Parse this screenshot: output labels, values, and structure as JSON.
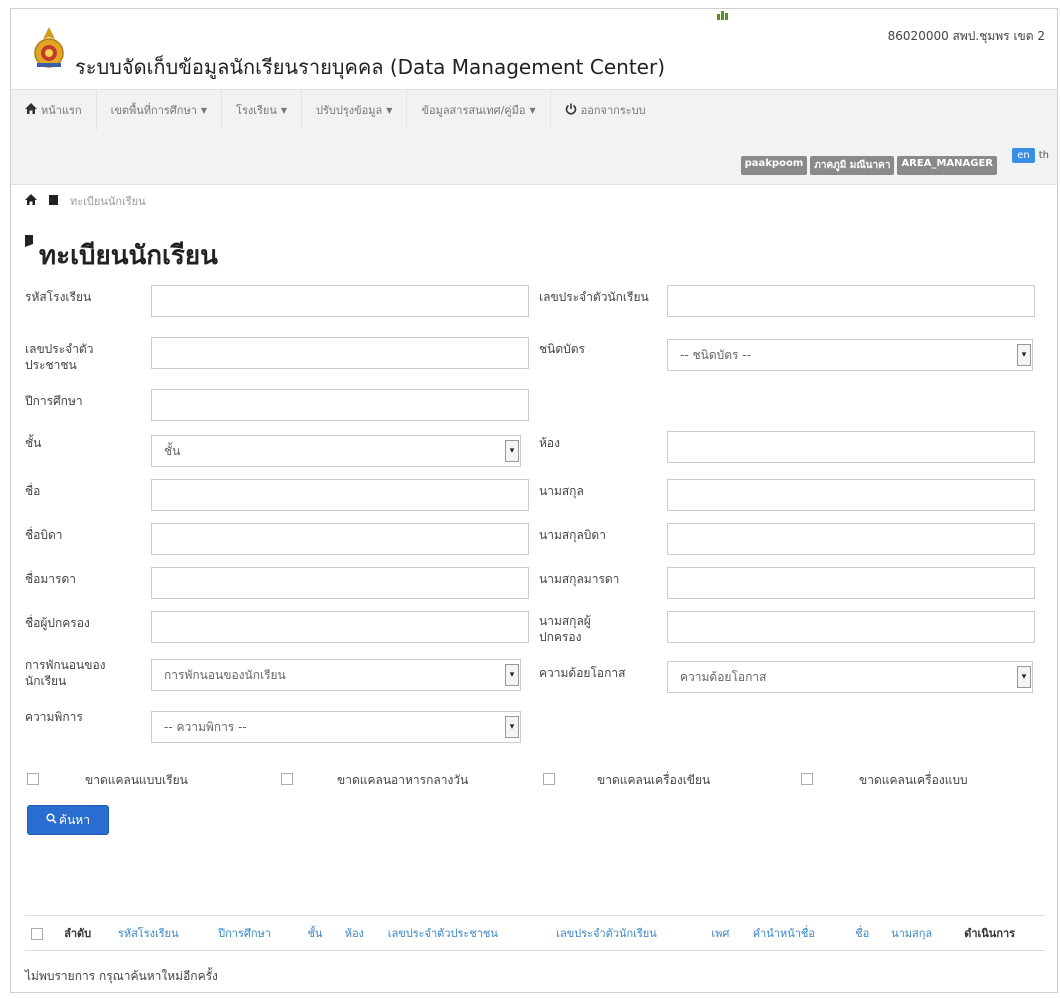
{
  "header": {
    "title": "ระบบจัดเก็บข้อมูลนักเรียนรายบุคคล (Data Management Center)",
    "user_info": "86020000 สพป.ชุมพร เขต 2"
  },
  "nav": {
    "items": [
      {
        "label": "หน้าแรก",
        "icon": "home-icon"
      },
      {
        "label": "เขตพื้นที่การศึกษา",
        "icon": "",
        "caret": true
      },
      {
        "label": "โรงเรียน",
        "icon": "",
        "caret": true
      },
      {
        "label": "ปรับปรุงข้อมูล",
        "icon": "",
        "caret": true
      },
      {
        "label": "ข้อมูลสารสนเทศ/คู่มือ",
        "icon": "",
        "caret": true
      },
      {
        "label": "ออกจากระบบ",
        "icon": "power-icon"
      }
    ],
    "badges": [
      "paakpoom",
      "ภาคภูมิ มณีนาคา",
      "AREA_MANAGER"
    ],
    "lang_en": "en",
    "lang_th": "th"
  },
  "breadcrumb": {
    "current": "ทะเบียนนักเรียน"
  },
  "page": {
    "title": "ทะเบียนนักเรียน"
  },
  "form": {
    "school_code": "รหัสโรงเรียน",
    "student_id": "เลขประจำตัวนักเรียน",
    "citizen_id": "เลขประจำตัวประชาชน",
    "card_type": "ชนิดบัตร",
    "card_type_value": "-- ชนิดบัตร --",
    "academic_year": "ปีการศึกษา",
    "grade": "ชั้น",
    "grade_value": "ชั้น",
    "room": "ห้อง",
    "first_name": "ชื่อ",
    "last_name": "นามสกุล",
    "father_name": "ชื่อบิดา",
    "father_last_name": "นามสกุลบิดา",
    "mother_name": "ชื่อมารดา",
    "mother_last_name": "นามสกุลมารดา",
    "guardian_name": "ชื่อผู้ปกครอง",
    "guardian_last_name": "นามสกุลผู้ปกครอง",
    "residence": "การพักนอนของนักเรียน",
    "residence_value": "การพักนอนของนักเรียน",
    "disadvantage": "ความด้อยโอกาส",
    "disadvantage_value": "ความด้อยโอกาส",
    "disability": "ความพิการ",
    "disability_value": "-- ความพิการ --",
    "checkboxes": [
      "ขาดแคลนแบบเรียน",
      "ขาดแคลนอาหารกลางวัน",
      "ขาดแคลนเครื่องเขียน",
      "ขาดแคลนเครื่องแบบ"
    ],
    "search_label": "ค้นหา"
  },
  "table": {
    "headers": [
      "ลำดับ",
      "รหัสโรงเรียน",
      "ปีการศึกษา",
      "ชั้น",
      "ห้อง",
      "เลขประจำตัวประชาชน",
      "เลขประจำตัวนักเรียน",
      "เพศ",
      "คำนำหน้าชื่อ",
      "ชื่อ",
      "นามสกุล",
      "ดำเนินการ"
    ],
    "empty_message": "ไม่พบรายการ กรุณาค้นหาใหม่อีกครั้ง"
  }
}
